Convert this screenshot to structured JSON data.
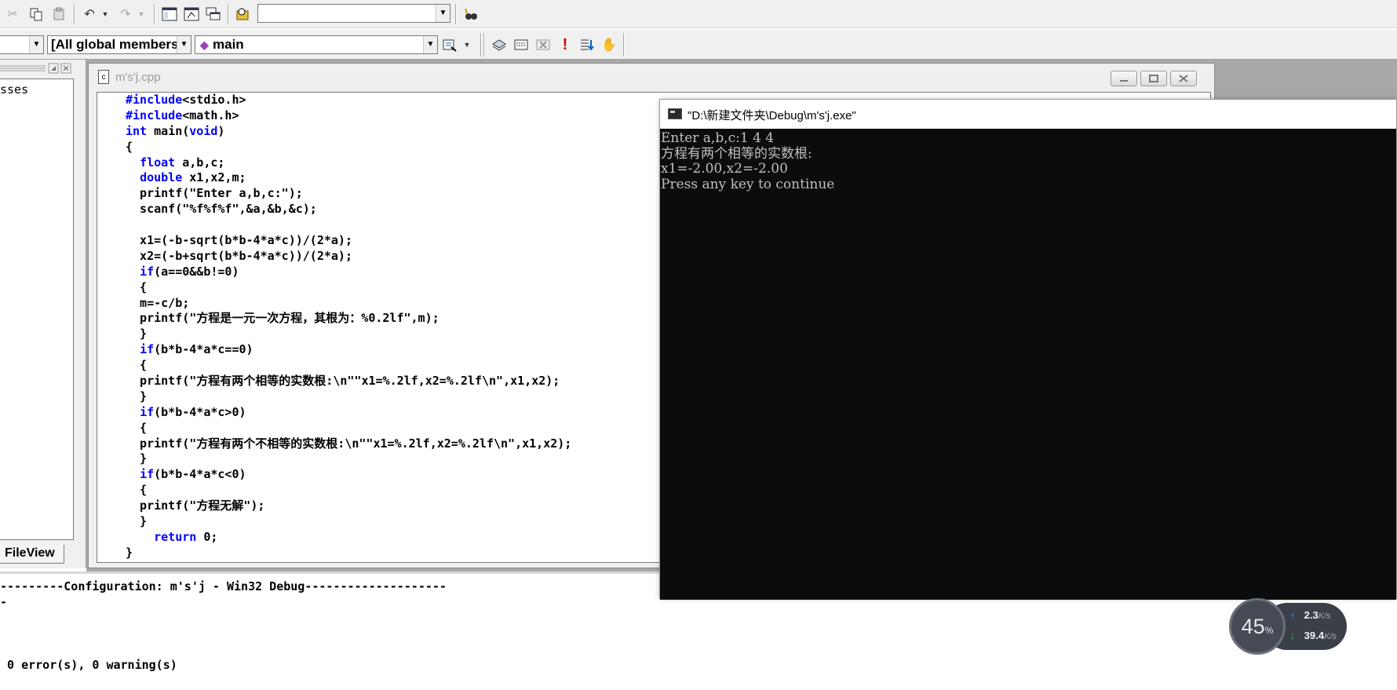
{
  "toolbar1": {
    "find_combo_value": ""
  },
  "toolbar2": {
    "class_combo_value": "",
    "members_combo_value": "[All global members",
    "function_combo_value": "main"
  },
  "workspace": {
    "tree_item": "sses",
    "tab_label": "FileView"
  },
  "editor": {
    "title": "m's'j.cpp",
    "code_lines": [
      "#include<stdio.h>",
      "#include<math.h>",
      "int main(void)",
      "{",
      "  float a,b,c;",
      "  double x1,x2,m;",
      "  printf(\"Enter a,b,c:\");",
      "  scanf(\"%f%f%f\",&a,&b,&c);",
      "",
      "  x1=(-b-sqrt(b*b-4*a*c))/(2*a);",
      "  x2=(-b+sqrt(b*b-4*a*c))/(2*a);",
      "  if(a==0&&b!=0)",
      "  {",
      "  m=-c/b;",
      "  printf(\"方程是一元一次方程，其根为：%0.2lf\",m);",
      "  }",
      "  if(b*b-4*a*c==0)",
      "  {",
      "  printf(\"方程有两个相等的实数根:\\n\"\"x1=%.2lf,x2=%.2lf\\n\",x1,x2);",
      "  }",
      "  if(b*b-4*a*c>0)",
      "  {",
      "  printf(\"方程有两个不相等的实数根:\\n\"\"x1=%.2lf,x2=%.2lf\\n\",x1,x2);",
      "  }",
      "  if(b*b-4*a*c<0)",
      "  {",
      "  printf(\"方程无解\");",
      "  }",
      "    return 0;",
      "}"
    ]
  },
  "output": {
    "lines": [
      "---------Configuration: m's'j - Win32 Debug--------------------",
      "-",
      "",
      "",
      "",
      " 0 error(s), 0 warning(s)"
    ]
  },
  "console": {
    "title": "\"D:\\新建文件夹\\Debug\\m's'j.exe\"",
    "lines": [
      "Enter a,b,c:1 4 4",
      "方程有两个相等的实数根:",
      "x1=-2.00,x2=-2.00",
      "Press any key to continue"
    ]
  },
  "net_widget": {
    "percent": "45",
    "percent_unit": "%",
    "upload": "2.3",
    "download": "39.4",
    "unit": "K/s"
  }
}
